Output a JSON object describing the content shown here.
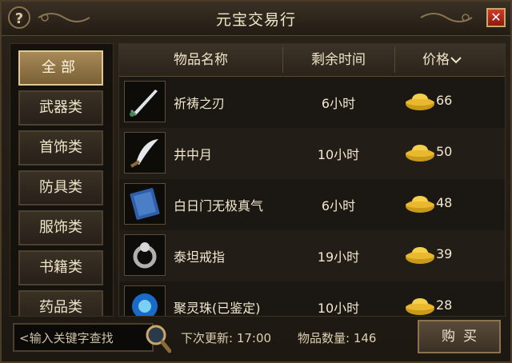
{
  "window": {
    "title": "元宝交易行",
    "help_label": "?",
    "close_label": "✕"
  },
  "categories": [
    {
      "label": "全部",
      "active": true
    },
    {
      "label": "武器类"
    },
    {
      "label": "首饰类"
    },
    {
      "label": "防具类"
    },
    {
      "label": "服饰类"
    },
    {
      "label": "书籍类"
    },
    {
      "label": "药品类"
    }
  ],
  "table": {
    "headers": {
      "name": "物品名称",
      "time": "剩余时间",
      "price": "价格"
    },
    "sort_icon": "chevron-down-icon",
    "rows": [
      {
        "icon": "sword-icon",
        "name": "祈祷之刃",
        "time": "6小时",
        "price": "66"
      },
      {
        "icon": "scimitar-icon",
        "name": "井中月",
        "time": "10小时",
        "price": "50"
      },
      {
        "icon": "book-icon",
        "name": "白日门无极真气",
        "time": "6小时",
        "price": "48"
      },
      {
        "icon": "ring-icon",
        "name": "泰坦戒指",
        "time": "19小时",
        "price": "39"
      },
      {
        "icon": "orb-icon",
        "name": "聚灵珠(已鉴定)",
        "time": "10小时",
        "price": "28"
      }
    ],
    "currency_icon": "gold-ingot-icon"
  },
  "footer": {
    "search_placeholder": "<输入关键字查找",
    "next_update": "下次更新: 17:00",
    "item_count": "物品数量: 146",
    "buy_label": "购买"
  },
  "colors": {
    "accent_gold": "#c9a86a",
    "close_red": "#c0301f",
    "background": "#1d1812"
  }
}
